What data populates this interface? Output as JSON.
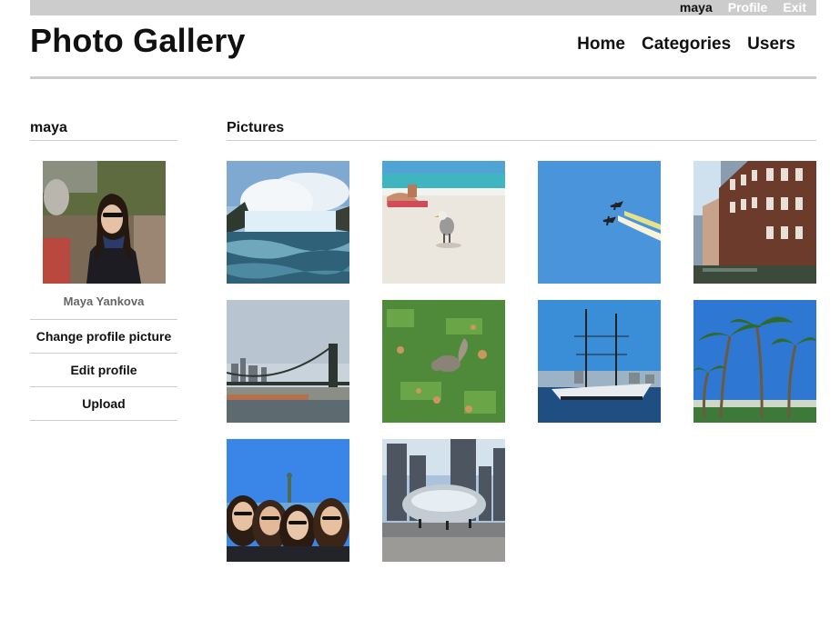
{
  "topbar": {
    "username": "maya",
    "profile_label": "Profile",
    "exit_label": "Exit"
  },
  "header": {
    "title": "Photo Gallery",
    "nav": [
      "Home",
      "Categories",
      "Users"
    ]
  },
  "sidebar": {
    "username": "maya",
    "full_name": "Maya Yankova",
    "links": [
      "Change profile picture",
      "Edit profile",
      "Upload"
    ]
  },
  "content": {
    "heading": "Pictures",
    "photos": [
      "waterfall-photo",
      "beach-seagull-photo",
      "airshow-planes-photo",
      "canal-buildings-photo",
      "bridge-skyline-photo",
      "squirrel-grass-photo",
      "sailing-ship-photo",
      "palm-trees-photo",
      "friends-statue-of-liberty-photo",
      "cloud-gate-bean-photo"
    ]
  },
  "colors": {
    "topbar_bg": "#cccccc",
    "divider": "#cccccc",
    "text": "#111111",
    "muted_text": "#666666"
  }
}
